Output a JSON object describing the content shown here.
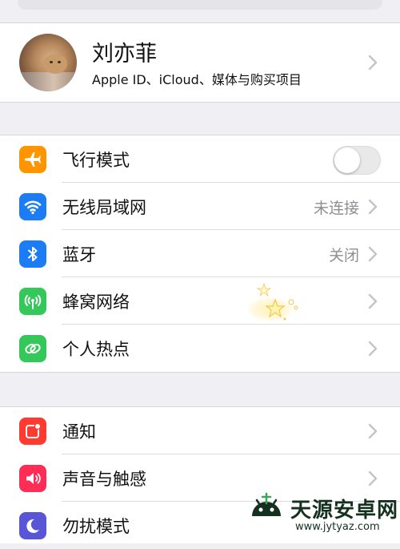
{
  "profile": {
    "name": "刘亦菲",
    "subtitle": "Apple ID、iCloud、媒体与购买项目"
  },
  "network_group": [
    {
      "label": "飞行模式",
      "icon": "airplane-icon",
      "color": "#ff9500",
      "control": "toggle",
      "toggle_on": false
    },
    {
      "label": "无线局域网",
      "icon": "wifi-icon",
      "color": "#1c7cf4",
      "value": "未连接"
    },
    {
      "label": "蓝牙",
      "icon": "bluetooth-icon",
      "color": "#1c7cf4",
      "value": "关闭"
    },
    {
      "label": "蜂窝网络",
      "icon": "cellular-icon",
      "color": "#34c759"
    },
    {
      "label": "个人热点",
      "icon": "hotspot-icon",
      "color": "#34c759"
    }
  ],
  "notify_group": [
    {
      "label": "通知",
      "icon": "notifications-icon",
      "color": "#ff3b30"
    },
    {
      "label": "声音与触感",
      "icon": "sound-icon",
      "color": "#ff2d55"
    },
    {
      "label": "勿扰模式",
      "icon": "moon-icon",
      "color": "#5856d6"
    }
  ],
  "watermark": {
    "title": "天源安卓网",
    "url": "www.jytyaz.com"
  }
}
